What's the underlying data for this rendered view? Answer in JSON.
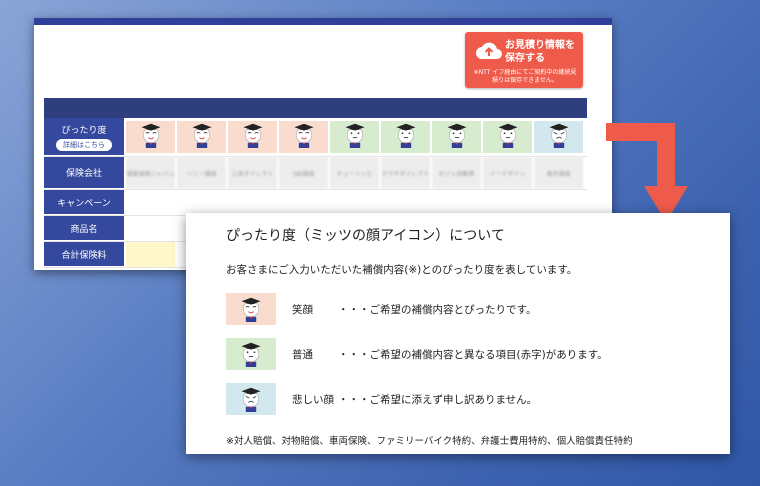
{
  "save_button": {
    "title": "お見積り情報を保存する",
    "note": "※NTT イフ経由にてご契約中の継続見積りは保存できません。"
  },
  "table": {
    "labels": {
      "fit": "ぴったり度",
      "detail": "詳細はこちら",
      "insurer": "保険会社",
      "campaign": "キャンペーン",
      "product": "商品名",
      "total": "合計保険料"
    },
    "face_colors": [
      "pink",
      "pink",
      "pink",
      "pink",
      "green",
      "green",
      "green",
      "green",
      "blue"
    ],
    "insurer_names": [
      "損害保険ジャパン",
      "ソニー損保",
      "三井ダイレクト",
      "SBI損保",
      "チューリッヒ",
      "アクサダイレクト",
      "セゾン自動車",
      "イーデザイン",
      "楽天損保"
    ]
  },
  "popup": {
    "title": "ぴったり度（ミッツの顔アイコン）について",
    "description": "お客さまにご入力いただいた補償内容(※)とのぴったり度を表しています。",
    "items": [
      {
        "name": "笑顔",
        "text": "・・・ご希望の補償内容とぴったりです。",
        "color": "#f9dcce"
      },
      {
        "name": "普通",
        "text": "・・・ご希望の補償内容と異なる項目(赤字)があります。",
        "color": "#d7ebcf"
      },
      {
        "name": "悲しい顔",
        "text": "・・・ご希望に添えず申し訳ありません。",
        "color": "#d3e7ee"
      }
    ],
    "note": "※対人賠償、対物賠償、車両保険、ファミリーバイク特約、弁護士費用特約、個人賠償責任特約"
  },
  "colors": {
    "accent_red": "#ef5b4a",
    "navy": "#34489e"
  }
}
